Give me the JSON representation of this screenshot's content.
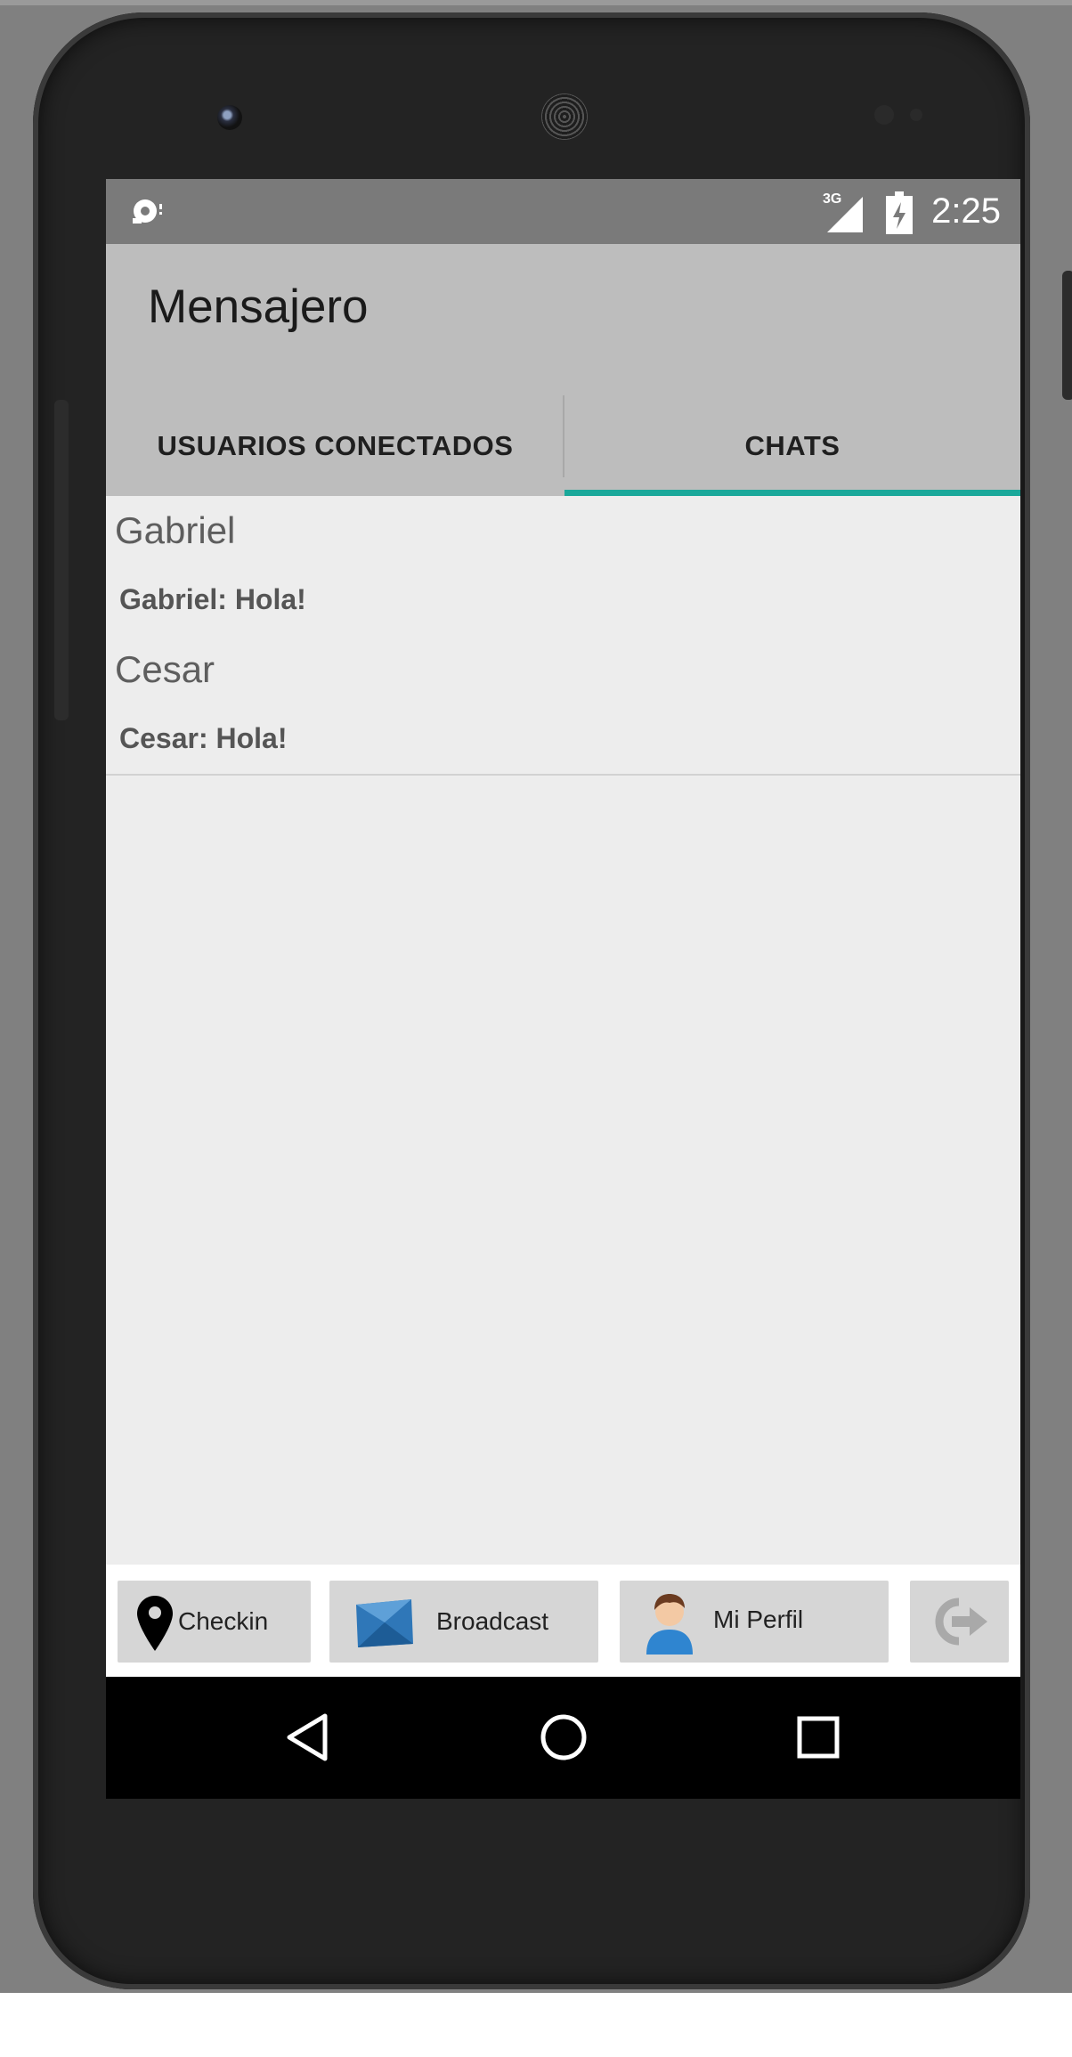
{
  "status_bar": {
    "notification_icon": "notification-icon",
    "network_label": "3G",
    "signal_icon": "signal-icon",
    "battery_icon": "battery-charging-icon",
    "time": "2:25"
  },
  "app_bar": {
    "title": "Mensajero"
  },
  "tabs": [
    {
      "label": "USUARIOS CONECTADOS",
      "selected": false
    },
    {
      "label": "CHATS",
      "selected": true
    }
  ],
  "chats": [
    {
      "name": "Gabriel",
      "preview": "Gabriel: Hola!"
    },
    {
      "name": "Cesar",
      "preview": "Cesar: Hola!"
    }
  ],
  "actions": {
    "checkin": {
      "label": "Checkin",
      "icon": "map-pin-icon"
    },
    "broadcast": {
      "label": "Broadcast",
      "icon": "envelope-icon"
    },
    "profile": {
      "label": "Mi Perfil",
      "icon": "user-avatar-icon"
    },
    "logout": {
      "icon": "logout-arrow-icon"
    }
  },
  "nav": {
    "back_icon": "back-triangle-icon",
    "home_icon": "home-circle-icon",
    "recents_icon": "recents-square-icon"
  },
  "colors": {
    "tab_indicator": "#1aa89a",
    "app_bar": "#bdbdbd",
    "status_bar": "#7a7a7a",
    "screen_background": "#ededed"
  }
}
